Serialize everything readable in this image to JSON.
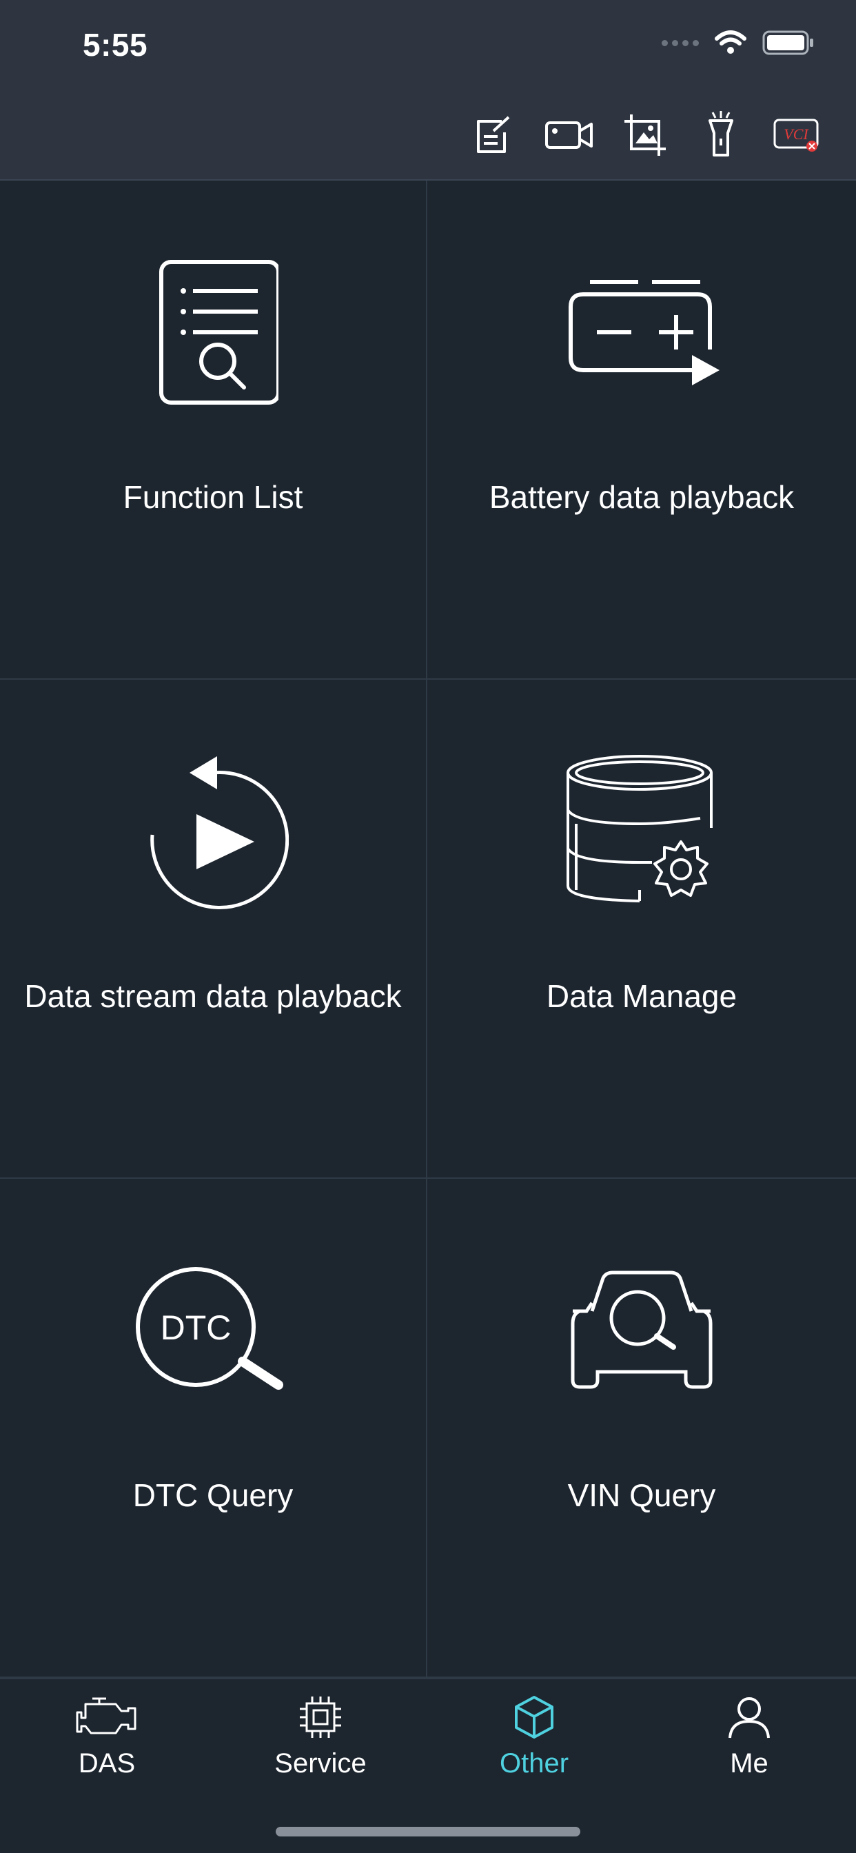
{
  "status_bar": {
    "time": "5:55"
  },
  "toolbar": {
    "icons": [
      "edit-note-icon",
      "video-camera-icon",
      "image-crop-icon",
      "flashlight-icon",
      "vci-status-icon"
    ],
    "vci_label": "VCI"
  },
  "grid": {
    "items": [
      {
        "label": "Function List",
        "icon": "document-search-icon"
      },
      {
        "label": "Battery data playback",
        "icon": "battery-playback-icon"
      },
      {
        "label": "Data stream data playback",
        "icon": "replay-icon"
      },
      {
        "label": "Data Manage",
        "icon": "database-gear-icon"
      },
      {
        "label": "DTC Query",
        "icon": "dtc-search-icon",
        "icon_text": "DTC"
      },
      {
        "label": "VIN Query",
        "icon": "car-search-icon"
      }
    ]
  },
  "tabbar": {
    "tabs": [
      {
        "label": "DAS",
        "icon": "engine-icon",
        "active": false
      },
      {
        "label": "Service",
        "icon": "chip-icon",
        "active": false
      },
      {
        "label": "Other",
        "icon": "cube-icon",
        "active": true
      },
      {
        "label": "Me",
        "icon": "person-icon",
        "active": false
      }
    ]
  },
  "colors": {
    "background": "#1d252f",
    "header": "#2e3540",
    "accent": "#4fd1e0",
    "vci_red": "#e23a3a"
  }
}
